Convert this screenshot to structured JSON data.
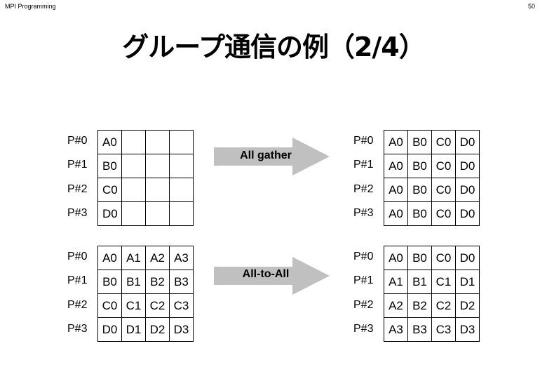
{
  "header": {
    "left": "MPI Programming",
    "page_number": "50"
  },
  "title": "グループ通信の例（2/4）",
  "colors": {
    "arrow_fill": "#c0c0c0",
    "border": "#000000"
  },
  "processes": [
    "P#0",
    "P#1",
    "P#2",
    "P#3"
  ],
  "examples": [
    {
      "operation": "All gather",
      "before": [
        [
          "A0",
          "",
          "",
          ""
        ],
        [
          "B0",
          "",
          "",
          ""
        ],
        [
          "C0",
          "",
          "",
          ""
        ],
        [
          "D0",
          "",
          "",
          ""
        ]
      ],
      "after": [
        [
          "A0",
          "B0",
          "C0",
          "D0"
        ],
        [
          "A0",
          "B0",
          "C0",
          "D0"
        ],
        [
          "A0",
          "B0",
          "C0",
          "D0"
        ],
        [
          "A0",
          "B0",
          "C0",
          "D0"
        ]
      ]
    },
    {
      "operation": "All-to-All",
      "before": [
        [
          "A0",
          "A1",
          "A2",
          "A3"
        ],
        [
          "B0",
          "B1",
          "B2",
          "B3"
        ],
        [
          "C0",
          "C1",
          "C2",
          "C3"
        ],
        [
          "D0",
          "D1",
          "D2",
          "D3"
        ]
      ],
      "after": [
        [
          "A0",
          "B0",
          "C0",
          "D0"
        ],
        [
          "A1",
          "B1",
          "C1",
          "D1"
        ],
        [
          "A2",
          "B2",
          "C2",
          "D2"
        ],
        [
          "A3",
          "B3",
          "C3",
          "D3"
        ]
      ]
    }
  ]
}
